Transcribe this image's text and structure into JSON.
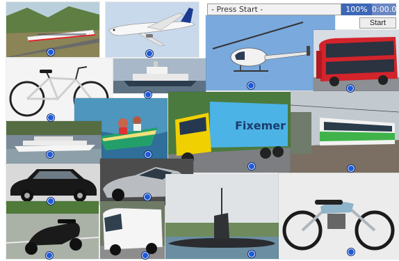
{
  "hud": {
    "status_text": "- Press Start -",
    "progress_text": "100%",
    "timer_text": "0:00.0",
    "start_label": "Start"
  },
  "colors": {
    "marker": "#1d5bd8",
    "progress_bg": "#3d67b6",
    "timer_bg": "#6b87c4"
  },
  "tiles": [
    {
      "name": "train-tile",
      "subject": "high-speed-train"
    },
    {
      "name": "airplane-tile",
      "subject": "airplane"
    },
    {
      "name": "helicopter-tile",
      "subject": "helicopter"
    },
    {
      "name": "bus-tile",
      "subject": "double-decker-bus"
    },
    {
      "name": "bicycle-tile",
      "subject": "bicycle"
    },
    {
      "name": "ferry-tile",
      "subject": "ferry"
    },
    {
      "name": "speedboat-tile",
      "subject": "speedboat"
    },
    {
      "name": "truck-tile",
      "subject": "truck"
    },
    {
      "name": "tram-tile",
      "subject": "tram"
    },
    {
      "name": "cruise-ship-tile",
      "subject": "cruise-ship"
    },
    {
      "name": "taxi-tile",
      "subject": "london-taxi"
    },
    {
      "name": "sports-car-tile",
      "subject": "sports-car"
    },
    {
      "name": "scooter-tile",
      "subject": "scooter"
    },
    {
      "name": "van-tile",
      "subject": "van"
    },
    {
      "name": "submarine-tile",
      "subject": "submarine"
    },
    {
      "name": "motorcycle-tile",
      "subject": "motorcycle"
    }
  ]
}
